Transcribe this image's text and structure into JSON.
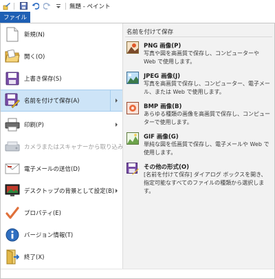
{
  "titlebar": {
    "title": "無題 - ペイント"
  },
  "file_tab": {
    "label": "ファイル"
  },
  "menu": {
    "items": [
      {
        "label": "新規(N)",
        "icon": "new-document-icon"
      },
      {
        "label": "開く(O)",
        "icon": "open-folder-icon"
      },
      {
        "label": "上書き保存(S)",
        "icon": "save-disk-icon"
      },
      {
        "label": "名前を付けて保存(A)",
        "icon": "save-as-icon"
      },
      {
        "label": "印刷(P)",
        "icon": "printer-icon"
      },
      {
        "label": "カメラまたはスキャナーから取り込み(M)",
        "icon": "scanner-icon"
      },
      {
        "label": "電子メールの送信(D)",
        "icon": "email-icon"
      },
      {
        "label": "デスクトップの背景として設定(B)",
        "icon": "desktop-background-icon"
      },
      {
        "label": "プロパティ(E)",
        "icon": "checkmark-icon"
      },
      {
        "label": "バージョン情報(T)",
        "icon": "info-icon"
      },
      {
        "label": "終了(X)",
        "icon": "exit-icon"
      }
    ]
  },
  "save_as": {
    "header": "名前を付けて保存",
    "options": [
      {
        "title": "PNG 画像(P)",
        "desc": "写真や図を高画質で保存し、コンピューターや Web で使用します。",
        "icon": "png-image-icon"
      },
      {
        "title": "JPEG 画像(J)",
        "desc": "写真を高画質で保存し、コンピューター、電子メール、または Web で使用します。",
        "icon": "jpeg-image-icon"
      },
      {
        "title": "BMP 画像(B)",
        "desc": "あらゆる種類の画像を高画質で保存し、コンピューターで使用します。",
        "icon": "bmp-image-icon"
      },
      {
        "title": "GIF 画像(G)",
        "desc": "単純な図を低画質で保存し、電子メールや Web で使用します。",
        "icon": "gif-image-icon"
      },
      {
        "title": "その他の形式(O)",
        "desc": "[名前を付けて保存] ダイアログ ボックスを開き、指定可能なすべてのファイルの種類から選択します。",
        "icon": "other-formats-icon"
      }
    ]
  },
  "colors": {
    "file_tab": "#1e5fb4",
    "selected_bg": "#cde4f7",
    "right_panel_bg": "#f2f2f2"
  }
}
